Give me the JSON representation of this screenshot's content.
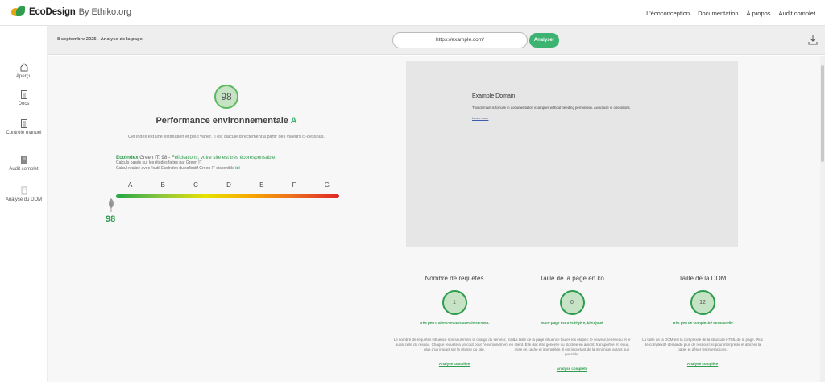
{
  "header": {
    "brand": "EcoDesign",
    "by": "By Ethiko.org",
    "nav": [
      "L'écoconception",
      "Documentation",
      "À propos",
      "Audit complet"
    ]
  },
  "sidebar": {
    "items": [
      {
        "label": "Aperçu",
        "icon": "home-icon"
      },
      {
        "label": "Docs",
        "icon": "document-icon"
      },
      {
        "label": "Contrôle manuel",
        "icon": "checklist-icon"
      },
      {
        "label": "Audit complet",
        "icon": "audit-icon"
      },
      {
        "label": "Analyse du DOM",
        "icon": "dom-icon"
      }
    ]
  },
  "toolbar": {
    "date_label": "8 septembre 2025 - Analyse de la page",
    "url_value": "https://example.com/",
    "analyse_label": "Analyser",
    "download_icon": "download-icon"
  },
  "performance": {
    "score": "98",
    "title": "Performance environnementale",
    "grade": "A",
    "description": "Cet index est une estimation et peut varier. Il est calculé directement à partir des valeurs ci-dessous.",
    "ecoindex_label": "EcoIndex",
    "ecoindex_line": " Green IT: 98 - ",
    "congrats": "Félicitations, votre site est très écoresponsable.",
    "note1": "Calculs basés sur les études faites par Green IT",
    "note2": "Calcul réalisé avec l'outil EcoIndex du collectif Green IT disponible ",
    "note2_link": "ici",
    "scale_letters": [
      "A",
      "B",
      "C",
      "D",
      "E",
      "F",
      "G"
    ],
    "marker_score": "98",
    "marker_position": 0.0
  },
  "preview": {
    "title": "Example Domain",
    "text": "This domain is for use in documentation examples without needing permission. Avoid use in operations.",
    "link": "Learn more"
  },
  "metrics": [
    {
      "title": "Nombre de requêtes",
      "value": "1",
      "verdict": "Très peu d'allers-retours avec le serveur.",
      "description": "Le nombre de requêtes influence non seulement la charge du serveur, mais aussi celle du réseau. Chaque requête a un coût pour l'environnement en plus d'un impact sur la vitesse du site.",
      "link": "Analyse complète"
    },
    {
      "title": "Taille de la page en ko",
      "value": "0",
      "verdict": "Votre page est très légère, bien joué",
      "description": "La taille de la page influence toutes les étapes: le serveur, le réseau et le client. Elle doit être générée ou stockée en amont, transportée et reçue, mise en cache et interprétée. Il est important de la minimiser autant que possible.",
      "link": "Analyse complète"
    },
    {
      "title": "Taille de la DOM",
      "value": "12",
      "verdict": "Très peu de complexité structurelle",
      "description": "La taille de la DOM est la complexité de la structure HTML de la page. Plus de complexité demande plus de ressources pour interpréter et afficher la page, et gêner les interactions.",
      "link": "Analyse complète"
    }
  ]
}
